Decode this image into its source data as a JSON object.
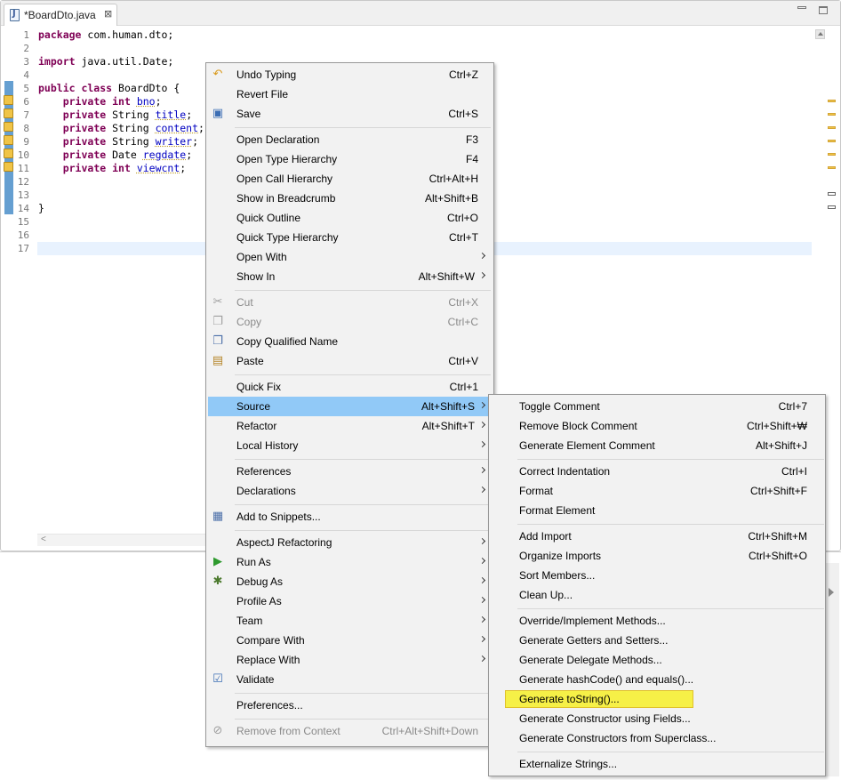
{
  "editor": {
    "tab_title": "*BoardDto.java",
    "tab_close": "⊠",
    "line_numbers": [
      "1",
      "2",
      "3",
      "4",
      "5",
      "6",
      "7",
      "8",
      "9",
      "10",
      "11",
      "12",
      "13",
      "14",
      "15",
      "16",
      "17"
    ],
    "code": {
      "l1_kw": "package",
      "l1_rest": " com.human.dto;",
      "l3_kw": "import",
      "l3_rest": " java.util.Date;",
      "l5_kw": "public class",
      "l5_rest": " BoardDto {",
      "l6_kw": "private int",
      "l6_field": "bno",
      "l6_end": ";",
      "l7_kw": "private",
      "l7_type": " String ",
      "l7_field": "title",
      "l7_end": ";",
      "l8_kw": "private",
      "l8_type": " String ",
      "l8_field": "content",
      "l8_end": ";",
      "l9_kw": "private",
      "l9_type": " String ",
      "l9_field": "writer",
      "l9_end": ";",
      "l10_kw": "private",
      "l10_type": " Date ",
      "l10_field": "regdate",
      "l10_end": ";",
      "l11_kw": "private int",
      "l11_field": "viewcnt",
      "l11_end": ";",
      "l14": "}"
    },
    "hscroll_arrow": "<"
  },
  "context_menu": {
    "items": [
      {
        "label": "Undo Typing",
        "shortcut": "Ctrl+Z",
        "icon": "undo-icon"
      },
      {
        "label": "Revert File",
        "shortcut": ""
      },
      {
        "label": "Save",
        "shortcut": "Ctrl+S",
        "icon": "save-icon"
      },
      {
        "label": "Open Declaration",
        "shortcut": "F3"
      },
      {
        "label": "Open Type Hierarchy",
        "shortcut": "F4"
      },
      {
        "label": "Open Call Hierarchy",
        "shortcut": "Ctrl+Alt+H"
      },
      {
        "label": "Show in Breadcrumb",
        "shortcut": "Alt+Shift+B"
      },
      {
        "label": "Quick Outline",
        "shortcut": "Ctrl+O"
      },
      {
        "label": "Quick Type Hierarchy",
        "shortcut": "Ctrl+T"
      },
      {
        "label": "Open With",
        "shortcut": ""
      },
      {
        "label": "Show In",
        "shortcut": "Alt+Shift+W"
      },
      {
        "label": "Cut",
        "shortcut": "Ctrl+X",
        "icon": "cut-icon"
      },
      {
        "label": "Copy",
        "shortcut": "Ctrl+C",
        "icon": "copy-icon"
      },
      {
        "label": "Copy Qualified Name",
        "shortcut": "",
        "icon": "copy-qualified-name-icon"
      },
      {
        "label": "Paste",
        "shortcut": "Ctrl+V",
        "icon": "paste-icon"
      },
      {
        "label": "Quick Fix",
        "shortcut": "Ctrl+1"
      },
      {
        "label": "Source",
        "shortcut": "Alt+Shift+S"
      },
      {
        "label": "Refactor",
        "shortcut": "Alt+Shift+T"
      },
      {
        "label": "Local History",
        "shortcut": ""
      },
      {
        "label": "References",
        "shortcut": ""
      },
      {
        "label": "Declarations",
        "shortcut": ""
      },
      {
        "label": "Add to Snippets...",
        "shortcut": "",
        "icon": "snippets-icon"
      },
      {
        "label": "AspectJ Refactoring",
        "shortcut": ""
      },
      {
        "label": "Run As",
        "shortcut": "",
        "icon": "run-icon"
      },
      {
        "label": "Debug As",
        "shortcut": "",
        "icon": "debug-icon"
      },
      {
        "label": "Profile As",
        "shortcut": ""
      },
      {
        "label": "Team",
        "shortcut": ""
      },
      {
        "label": "Compare With",
        "shortcut": ""
      },
      {
        "label": "Replace With",
        "shortcut": ""
      },
      {
        "label": "Validate",
        "shortcut": "",
        "icon": "validate-checkbox-icon"
      },
      {
        "label": "Preferences...",
        "shortcut": ""
      },
      {
        "label": "Remove from Context",
        "shortcut": "Ctrl+Alt+Shift+Down",
        "icon": "remove-context-icon"
      }
    ]
  },
  "source_submenu": {
    "items": [
      {
        "label": "Toggle Comment",
        "shortcut": "Ctrl+7"
      },
      {
        "label": "Remove Block Comment",
        "shortcut": "Ctrl+Shift+₩"
      },
      {
        "label": "Generate Element Comment",
        "shortcut": "Alt+Shift+J"
      },
      {
        "label": "Correct Indentation",
        "shortcut": "Ctrl+I"
      },
      {
        "label": "Format",
        "shortcut": "Ctrl+Shift+F"
      },
      {
        "label": "Format Element",
        "shortcut": ""
      },
      {
        "label": "Add Import",
        "shortcut": "Ctrl+Shift+M"
      },
      {
        "label": "Organize Imports",
        "shortcut": "Ctrl+Shift+O"
      },
      {
        "label": "Sort Members...",
        "shortcut": ""
      },
      {
        "label": "Clean Up...",
        "shortcut": ""
      },
      {
        "label": "Override/Implement Methods...",
        "shortcut": ""
      },
      {
        "label": "Generate Getters and Setters...",
        "shortcut": ""
      },
      {
        "label": "Generate Delegate Methods...",
        "shortcut": ""
      },
      {
        "label": "Generate hashCode() and equals()...",
        "shortcut": ""
      },
      {
        "label": "Generate toString()...",
        "shortcut": ""
      },
      {
        "label": "Generate Constructor using Fields...",
        "shortcut": ""
      },
      {
        "label": "Generate Constructors from Superclass...",
        "shortcut": ""
      },
      {
        "label": "Externalize Strings...",
        "shortcut": ""
      }
    ]
  },
  "colors": {
    "menu_highlight": "#91c9f7",
    "generate_tostring_highlight": "#f6f047",
    "keyword": "#7f0055",
    "field": "#0000c0"
  }
}
